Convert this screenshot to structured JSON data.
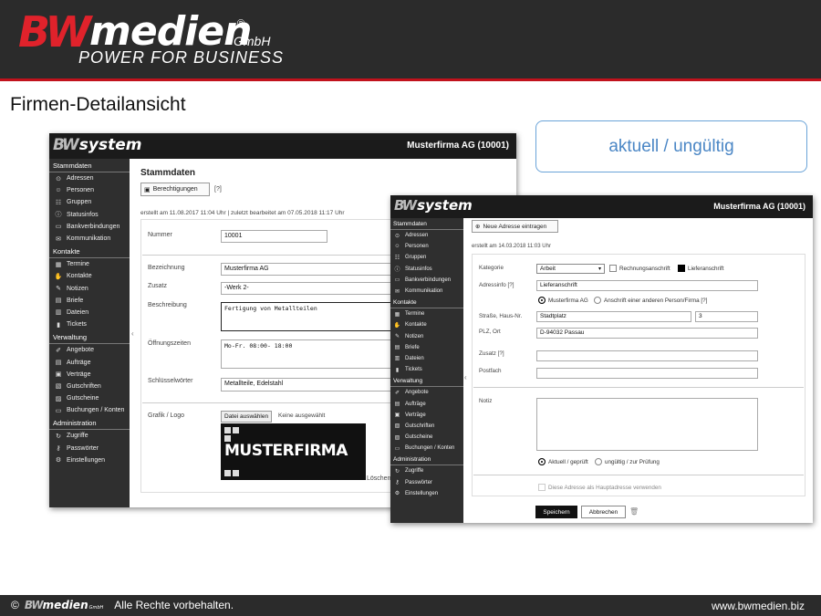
{
  "header": {
    "brand_bw": "BW",
    "brand_medien": "medien",
    "brand_reg": "®",
    "brand_gmbh": "GmbH",
    "tagline": "POWER FOR BUSINESS"
  },
  "page_title": "Firmen-Detailansicht",
  "status_box": "aktuell / ungültig",
  "app": {
    "logo_bw": "BW",
    "logo_system": "system",
    "company": "Musterfirma AG (10001)",
    "sidebar": {
      "stammdaten": {
        "title": "Stammdaten",
        "items": [
          {
            "label": "Adressen",
            "icon": "location-pin-icon"
          },
          {
            "label": "Personen",
            "icon": "person-icon"
          },
          {
            "label": "Gruppen",
            "icon": "group-icon"
          },
          {
            "label": "Statusinfos",
            "icon": "info-icon"
          },
          {
            "label": "Bankverbindungen",
            "icon": "credit-card-icon"
          },
          {
            "label": "Kommunikation",
            "icon": "envelope-icon"
          }
        ]
      },
      "kontakte": {
        "title": "Kontakte",
        "items": [
          {
            "label": "Termine",
            "icon": "calendar-icon"
          },
          {
            "label": "Kontakte",
            "icon": "handshake-icon"
          },
          {
            "label": "Notizen",
            "icon": "pencil-icon"
          },
          {
            "label": "Briefe",
            "icon": "document-icon"
          },
          {
            "label": "Dateien",
            "icon": "files-icon"
          },
          {
            "label": "Tickets",
            "icon": "ticket-icon"
          }
        ]
      },
      "verwaltung": {
        "title": "Verwaltung",
        "items": [
          {
            "label": "Angebote",
            "icon": "edit-icon"
          },
          {
            "label": "Aufträge",
            "icon": "order-icon"
          },
          {
            "label": "Verträge",
            "icon": "contract-icon"
          },
          {
            "label": "Gutschriften",
            "icon": "credit-note-icon"
          },
          {
            "label": "Gutscheine",
            "icon": "voucher-icon"
          },
          {
            "label": "Buchungen / Konten",
            "icon": "accounts-icon"
          }
        ]
      },
      "administration": {
        "title": "Administration",
        "items": [
          {
            "label": "Zugriffe",
            "icon": "access-icon"
          },
          {
            "label": "Passwörter",
            "icon": "key-icon"
          },
          {
            "label": "Einstellungen",
            "icon": "gear-icon"
          }
        ]
      }
    }
  },
  "window1": {
    "section_title": "Stammdaten",
    "permissions_button": "Berechtigungen",
    "help": "[?]",
    "meta": "erstellt am 11.08.2017 11:04 Uhr | zuletzt bearbeitet am 07.05.2018 11:17 Uhr",
    "fields": {
      "nummer_label": "Nummer",
      "nummer_value": "10001",
      "bezeichnung_label": "Bezeichnung",
      "bezeichnung_value": "Musterfirma AG",
      "zusatz_label": "Zusatz",
      "zusatz_value": "-Werk 2-",
      "beschreibung_label": "Beschreibung",
      "beschreibung_value": "Fertigung von Metallteilen",
      "oeffnungszeiten_label": "Öffnungszeiten",
      "oeffnungszeiten_value": "Mo-Fr. 08:00- 18:00",
      "schluesselwoerter_label": "Schlüsselwörter",
      "schluesselwoerter_value": "Metallteile, Edelstahl",
      "grafik_label": "Grafik / Logo",
      "file_button": "Datei auswählen",
      "file_none": "Keine ausgewählt",
      "logo_text": "MUSTERFIRMA",
      "delete_text": "Löschen"
    }
  },
  "window2": {
    "new_address_button": "Neue Adresse eintragen",
    "meta": "erstellt am 14.03.2018 11:03 Uhr",
    "kategorie_label": "Kategorie",
    "kategorie_value": "Arbeit",
    "rechnungsanschrift": "Rechnungsanschrift",
    "lieferanschrift": "Lieferanschrift",
    "adressinfo_label": "Adressinfo [?]",
    "adressinfo_value": "Lieferanschrift",
    "radio_musterfirma": "Musterfirma AG",
    "radio_andere": "Anschrift einer anderen Person/Firma [?]",
    "strasse_label": "Straße, Haus-Nr.",
    "strasse_value": "Stadtplatz",
    "hausnr_value": "3",
    "plz_label": "PLZ, Ort",
    "plz_value": "D-94032 Passau",
    "zusatz_label": "Zusatz [?]",
    "postfach_label": "Postfach",
    "notiz_label": "Notiz",
    "radio_aktuell": "Aktuell / geprüft",
    "radio_ungueltig": "ungültig / zur Prüfung",
    "hauptadresse": "Diese Adresse als Hauptadresse verwenden",
    "save_button": "Speichern",
    "cancel_button": "Abbrechen"
  },
  "footer": {
    "copyright": "©",
    "logo_bw": "BW",
    "logo_medien": "medien",
    "logo_gmbh": "GmbH",
    "rights": "Alle Rechte vorbehalten.",
    "url": "www.bwmedien.biz"
  }
}
